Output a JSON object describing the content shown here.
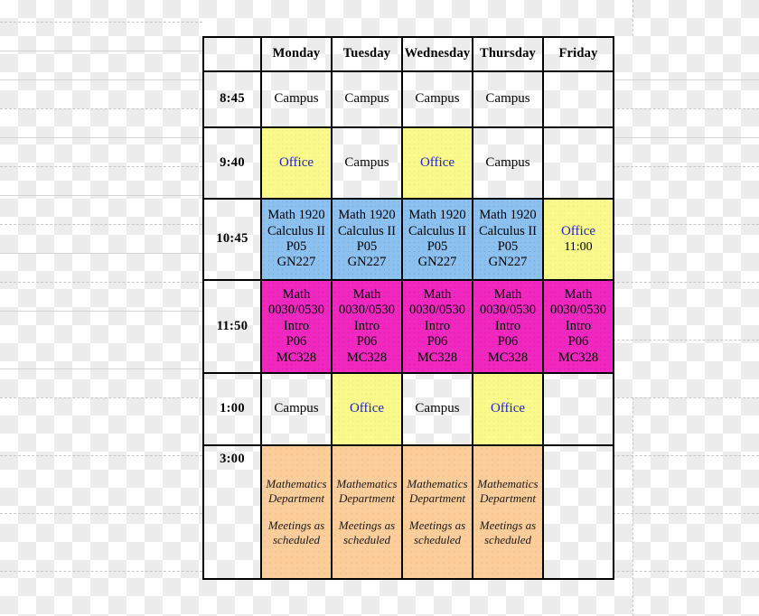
{
  "table": {
    "corner_label": "",
    "day_headers": [
      "Monday",
      "Tuesday",
      "Wednesday",
      "Thursday",
      "Friday"
    ],
    "times": [
      "8:45",
      "9:40",
      "10:45",
      "11:50",
      "1:00",
      "3:00"
    ],
    "rows": [
      {
        "time": "8:45",
        "cells": [
          {
            "fill": "none",
            "style": "plain",
            "lines": [
              "Campus"
            ]
          },
          {
            "fill": "none",
            "style": "plain",
            "lines": [
              "Campus"
            ]
          },
          {
            "fill": "none",
            "style": "plain",
            "lines": [
              "Campus"
            ]
          },
          {
            "fill": "none",
            "style": "plain",
            "lines": [
              "Campus"
            ]
          },
          {
            "fill": "none",
            "style": "plain",
            "lines": []
          }
        ]
      },
      {
        "time": "9:40",
        "cells": [
          {
            "fill": "yellow",
            "style": "office",
            "lines": [
              "Office"
            ]
          },
          {
            "fill": "none",
            "style": "plain",
            "lines": [
              "Campus"
            ]
          },
          {
            "fill": "yellow",
            "style": "office",
            "lines": [
              "Office"
            ]
          },
          {
            "fill": "none",
            "style": "plain",
            "lines": [
              "Campus"
            ]
          },
          {
            "fill": "none",
            "style": "plain",
            "lines": []
          }
        ]
      },
      {
        "time": "10:45",
        "cells": [
          {
            "fill": "blue",
            "style": "course",
            "lines": [
              "Math 1920",
              "Calculus II",
              "P05",
              "GN227"
            ]
          },
          {
            "fill": "blue",
            "style": "course",
            "lines": [
              "Math 1920",
              "Calculus II",
              "P05",
              "GN227"
            ]
          },
          {
            "fill": "blue",
            "style": "course",
            "lines": [
              "Math 1920",
              "Calculus II",
              "P05",
              "GN227"
            ]
          },
          {
            "fill": "blue",
            "style": "course",
            "lines": [
              "Math 1920",
              "Calculus II",
              "P05",
              "GN227"
            ]
          },
          {
            "fill": "yellow",
            "style": "office-time",
            "lines": [
              "Office",
              "11:00"
            ]
          }
        ]
      },
      {
        "time": "11:50",
        "cells": [
          {
            "fill": "magenta",
            "style": "course",
            "lines": [
              "Math",
              "0030/0530",
              "Intro",
              "P06",
              "MC328"
            ]
          },
          {
            "fill": "magenta",
            "style": "course",
            "lines": [
              "Math",
              "0030/0530",
              "Intro",
              "P06",
              "MC328"
            ]
          },
          {
            "fill": "magenta",
            "style": "course",
            "lines": [
              "Math",
              "0030/0530",
              "Intro",
              "P06",
              "MC328"
            ]
          },
          {
            "fill": "magenta",
            "style": "course",
            "lines": [
              "Math",
              "0030/0530",
              "Intro",
              "P06",
              "MC328"
            ]
          },
          {
            "fill": "magenta",
            "style": "course",
            "lines": [
              "Math",
              "0030/0530",
              "Intro",
              "P06",
              "MC328"
            ]
          }
        ]
      },
      {
        "time": "1:00",
        "cells": [
          {
            "fill": "none",
            "style": "plain",
            "lines": [
              "Campus"
            ]
          },
          {
            "fill": "yellow",
            "style": "office",
            "lines": [
              "Office"
            ]
          },
          {
            "fill": "none",
            "style": "plain",
            "lines": [
              "Campus"
            ]
          },
          {
            "fill": "yellow",
            "style": "office",
            "lines": [
              "Office"
            ]
          },
          {
            "fill": "none",
            "style": "plain",
            "lines": []
          }
        ]
      },
      {
        "time": "3:00",
        "cells": [
          {
            "fill": "orange",
            "style": "dept",
            "group_a": [
              "Mathematics",
              "Department"
            ],
            "group_b": [
              "Meetings as",
              "scheduled"
            ]
          },
          {
            "fill": "orange",
            "style": "dept",
            "group_a": [
              "Mathematics",
              "Department"
            ],
            "group_b": [
              "Meetings as",
              "scheduled"
            ]
          },
          {
            "fill": "orange",
            "style": "dept",
            "group_a": [
              "Mathematics",
              "Department"
            ],
            "group_b": [
              "Meetings as",
              "scheduled"
            ]
          },
          {
            "fill": "orange",
            "style": "dept",
            "group_a": [
              "Mathematics",
              "Department"
            ],
            "group_b": [
              "Meetings as",
              "scheduled"
            ]
          },
          {
            "fill": "none",
            "style": "plain",
            "lines": []
          }
        ]
      }
    ]
  },
  "colors": {
    "header_text": "#c0241e",
    "time_text": "#b81a1a",
    "office_text": "#2020d0",
    "fill_blue": "#8cc0ef",
    "fill_yellow": "#fafa8c",
    "fill_magenta": "#f028c0",
    "fill_orange": "#facd9b",
    "border": "#000000"
  }
}
